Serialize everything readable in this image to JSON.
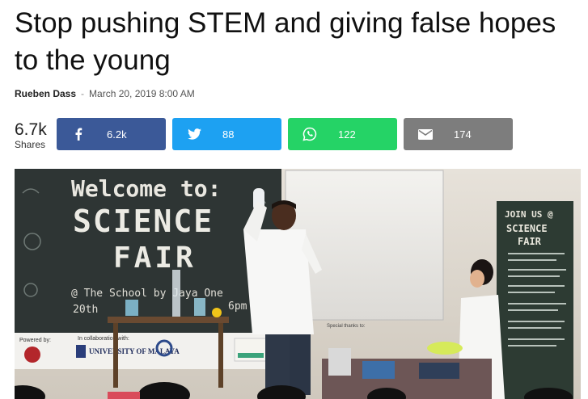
{
  "article": {
    "title": "Stop pushing STEM and giving false hopes to the young",
    "author": "Rueben Dass",
    "separator": "-",
    "date": "March 20, 2019 8:00 AM"
  },
  "shares": {
    "total": "6.7k",
    "label": "Shares",
    "buttons": [
      {
        "network": "facebook",
        "icon": "facebook-icon",
        "count": "6.2k",
        "color": "#3b5998"
      },
      {
        "network": "twitter",
        "icon": "twitter-icon",
        "count": "88",
        "color": "#1da1f2"
      },
      {
        "network": "whatsapp",
        "icon": "whatsapp-icon",
        "count": "122",
        "color": "#25d366"
      },
      {
        "network": "email",
        "icon": "mail-icon",
        "count": "174",
        "color": "#7d7d7d"
      }
    ]
  },
  "image": {
    "board_line1": "Welcome to:",
    "board_line2": "SCIENCE",
    "board_line3": "FAIR",
    "board_line4": "@ The School by Jaya One",
    "board_line5": "20th",
    "board_line6": "6pm",
    "poster_line1": "JOIN US @",
    "poster_line2": "SCIENCE",
    "poster_line3": "FAIR",
    "powered_by": "Powered by:",
    "collab": "In collaboration with:",
    "univ": "UNIVERSITY OF MALAYA",
    "special": "Special thanks to:"
  }
}
